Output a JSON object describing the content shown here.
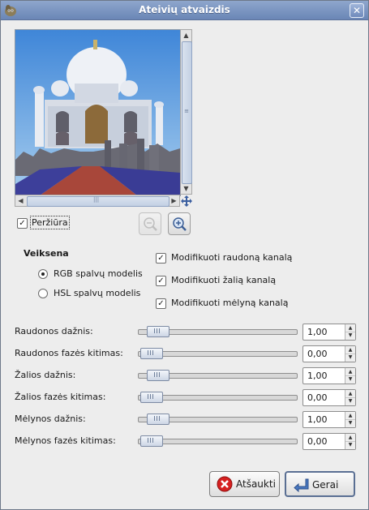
{
  "window": {
    "title": "Ateivių atvaizdis"
  },
  "preview": {
    "checkbox_label": "Peržiūra",
    "checked": true,
    "image_icon": "taj-mahal-image-preview",
    "zoom_out_enabled": false,
    "zoom_in_enabled": true
  },
  "mode": {
    "title": "Veiksena",
    "options": [
      {
        "label": "RGB spalvų modelis",
        "selected": true
      },
      {
        "label": "HSL spalvų modelis",
        "selected": false
      }
    ]
  },
  "channels": [
    {
      "label": "Modifikuoti raudoną kanalą",
      "checked": true
    },
    {
      "label": "Modifikuoti žalią kanalą",
      "checked": true
    },
    {
      "label": "Modifikuoti mėlyną kanalą",
      "checked": true
    }
  ],
  "sliders": [
    {
      "label": "Raudonos dažnis:",
      "value": "1,00",
      "fraction": 0.05
    },
    {
      "label": "Raudonos fazės kitimas:",
      "value": "0,00",
      "fraction": 0.0
    },
    {
      "label": "Žalios dažnis:",
      "value": "1,00",
      "fraction": 0.05
    },
    {
      "label": "Žalios fazės kitimas:",
      "value": "0,00",
      "fraction": 0.0
    },
    {
      "label": "Mėlynos dažnis:",
      "value": "1,00",
      "fraction": 0.05
    },
    {
      "label": "Mėlynos fazės kitimas:",
      "value": "0,00",
      "fraction": 0.0
    }
  ],
  "buttons": {
    "cancel": "Atšaukti",
    "ok": "Gerai"
  },
  "colors": {
    "titlebar": "#7b95c2",
    "cancel_icon": "#d62020",
    "ok_icon": "#4a78c0"
  }
}
